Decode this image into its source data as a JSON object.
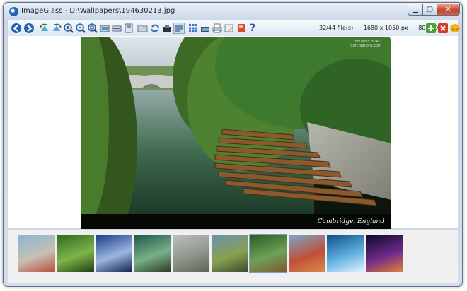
{
  "window": {
    "title": "ImageGlass - D:\\Wallpapers\\194630213.jpg",
    "min_glyph": "▁",
    "max_glyph": "▢",
    "close_glyph": "✕"
  },
  "toolbar": {
    "buttons": [
      "back",
      "forward",
      "rotate-left",
      "rotate-right",
      "zoom-in",
      "zoom-out",
      "zoom-fit",
      "actual-size",
      "scale-to-width",
      "scale-to-height",
      "open-folder",
      "refresh",
      "set-wallpaper",
      "thumbnail",
      "checkerboard",
      "zoom-lock",
      "print",
      "edit",
      "delete",
      "about"
    ],
    "about_glyph": "?"
  },
  "status": {
    "file_count": "32/44 file(s)",
    "resolution": "1680 x 1050 px",
    "file_size": "807.49 KB"
  },
  "right_buttons": [
    "add-icon",
    "remove-icon",
    "like-icon"
  ],
  "photo": {
    "caption": "Cambridge, England",
    "credit_line1": "Eduardo HDRG",
    "credit_line2": "hdrcreations.com"
  },
  "thumbnails": [
    {
      "name": "coast-rocks",
      "colors": [
        "#8db4d6",
        "#c7c0b3",
        "#b5503a"
      ]
    },
    {
      "name": "green-grass",
      "colors": [
        "#2f6a22",
        "#7fb548",
        "#1e3f15"
      ]
    },
    {
      "name": "blue-sky-clouds",
      "colors": [
        "#1a3c8a",
        "#9cb6e0",
        "#0f2150"
      ]
    },
    {
      "name": "tree-planet",
      "colors": [
        "#1f5a46",
        "#78b08a",
        "#2a3a1e"
      ]
    },
    {
      "name": "misty-forest",
      "colors": [
        "#bdbfbc",
        "#8e958c",
        "#5a6654"
      ]
    },
    {
      "name": "mountain-field",
      "colors": [
        "#6e8fb2",
        "#88a14f",
        "#3c4a2e"
      ]
    },
    {
      "name": "cambridge-river",
      "colors": [
        "#2c5b25",
        "#6fa055",
        "#7a5a38"
      ]
    },
    {
      "name": "autumn-lake",
      "colors": [
        "#7aa7c9",
        "#c0503a",
        "#d68a4a"
      ]
    },
    {
      "name": "blue-bubbles",
      "colors": [
        "#0d4f86",
        "#5fb1e0",
        "#dff2ff"
      ]
    },
    {
      "name": "colorful-swirl",
      "colors": [
        "#0a0a2a",
        "#6c2a8a",
        "#e0803a"
      ]
    }
  ]
}
